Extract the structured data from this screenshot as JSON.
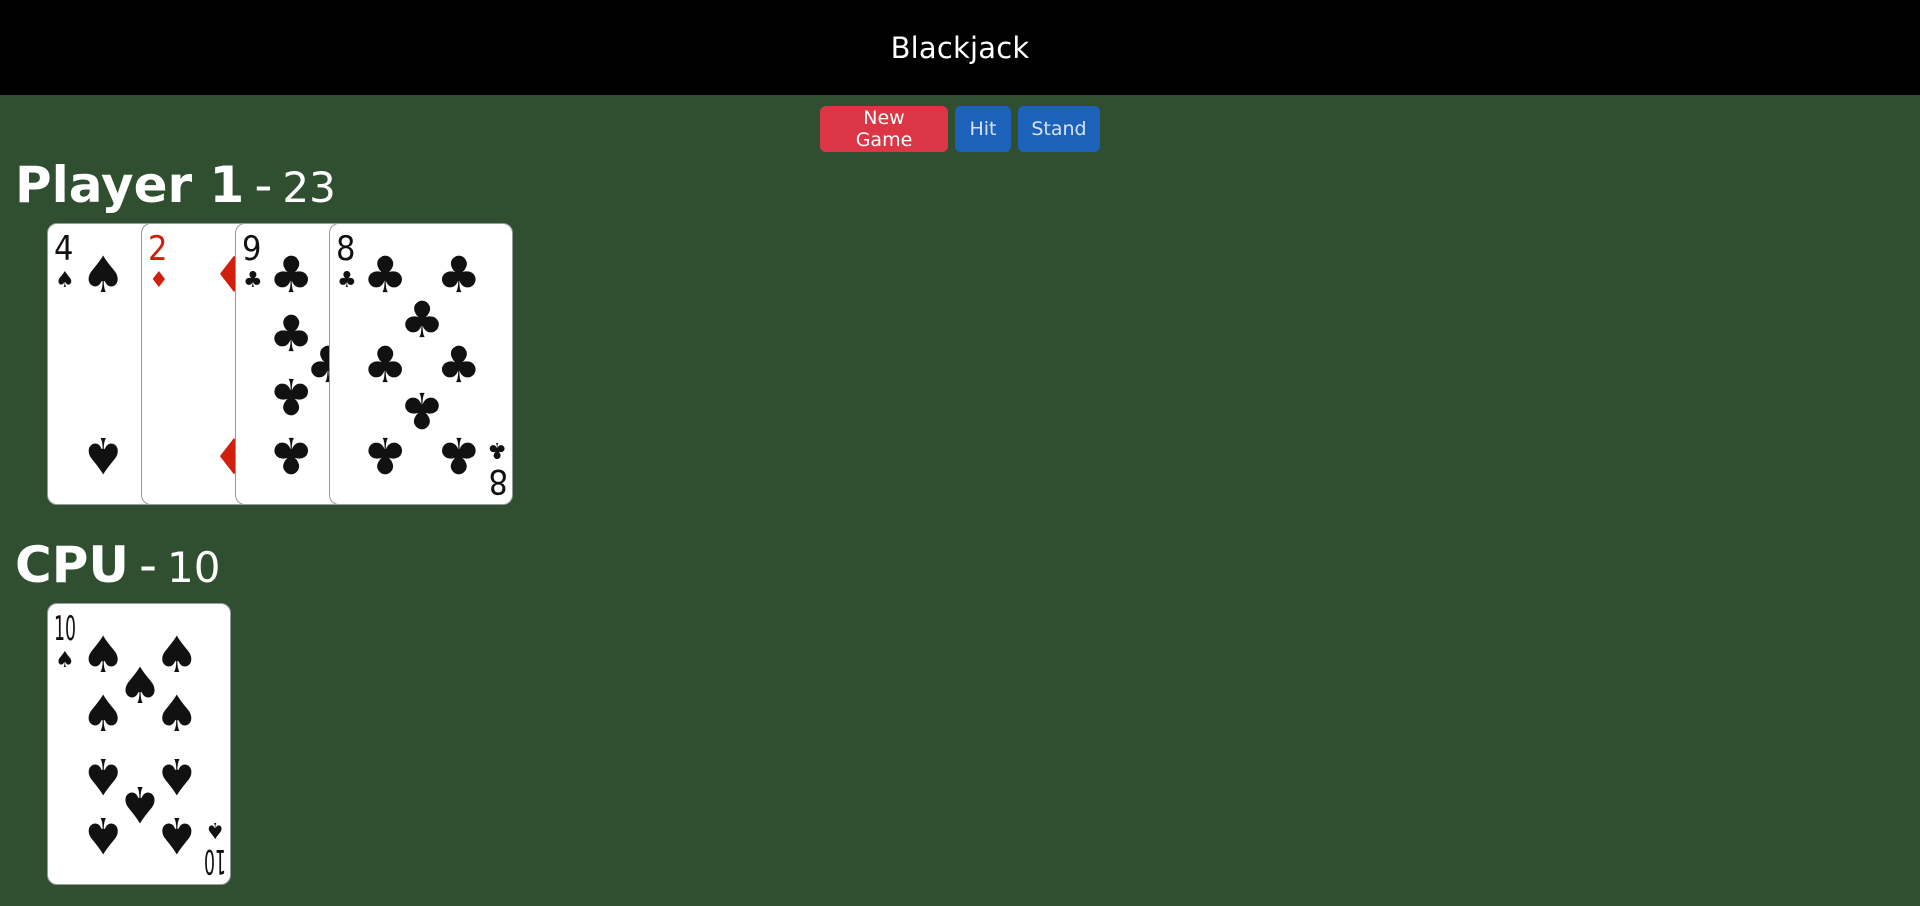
{
  "header": {
    "title": "Blackjack"
  },
  "controls": {
    "new_game_label": "New Game",
    "hit_label": "Hit",
    "stand_label": "Stand"
  },
  "player": {
    "name": "Player 1",
    "separator": "-",
    "score": "23",
    "cards": [
      {
        "rank": "4",
        "suit": "spades"
      },
      {
        "rank": "2",
        "suit": "diamonds"
      },
      {
        "rank": "9",
        "suit": "clubs"
      },
      {
        "rank": "8",
        "suit": "clubs"
      }
    ]
  },
  "cpu": {
    "name": "CPU",
    "separator": "-",
    "score": "10",
    "cards": [
      {
        "rank": "10",
        "suit": "spades"
      }
    ]
  },
  "colors": {
    "table": "#304f31",
    "header": "#000000",
    "new_game": "#dc3545",
    "action": "#1c62bb",
    "red_suit": "#d0200d",
    "black_suit": "#111111"
  }
}
